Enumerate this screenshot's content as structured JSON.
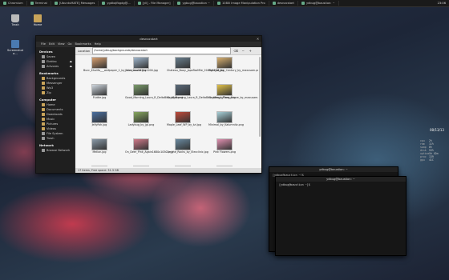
{
  "taskbar": {
    "items": [
      {
        "label": "Chromium"
      },
      {
        "label": "Terminal"
      },
      {
        "label": "[UbuntuMATE] Messages"
      },
      {
        "label": "ygdkajfbgdg@..."
      },
      {
        "label": "[yll] - File Manager]"
      },
      {
        "label": "ygbug@baustion ~"
      },
      {
        "label": "1080i Image Manipulation Pro"
      },
      {
        "label": "desnacstart"
      },
      {
        "label": "ydbug@baustion: ~"
      }
    ],
    "clock": "23:06"
  },
  "desktop": {
    "icons": [
      {
        "label": "Trash"
      },
      {
        "label": "Home"
      },
      {
        "label": "Screenshot a..."
      }
    ]
  },
  "file_manager": {
    "title": "desnacstart",
    "menu": [
      "File",
      "Edit",
      "View",
      "Go",
      "Bookmarks",
      "Help"
    ],
    "sidebar": {
      "devices_heading": "Devices",
      "devices": [
        {
          "label": "Seven"
        },
        {
          "label": "Elektro"
        },
        {
          "label": "Artvores"
        }
      ],
      "bookmarks_heading": "Bookmarks",
      "bookmarks": [
        {
          "label": "Backgrounds"
        },
        {
          "label": "Messenger"
        },
        {
          "label": "Wp3"
        },
        {
          "label": "Zip"
        }
      ],
      "computer_heading": "Computer",
      "computer": [
        {
          "label": "Home"
        },
        {
          "label": "Documents"
        },
        {
          "label": "Downloads"
        },
        {
          "label": "Music"
        },
        {
          "label": "Pictures"
        },
        {
          "label": "Videos"
        },
        {
          "label": "File System"
        },
        {
          "label": "Trash"
        }
      ],
      "network_heading": "Network",
      "network": [
        {
          "label": "Browse Network"
        }
      ]
    },
    "location_label": "Location",
    "location_value": "/home/ydbug/backgrounds/desnacstart",
    "files": [
      {
        "name": "Bucc_Khalifa___wallpaper_1_by_mox_laseke.jpg",
        "color": "#d9a070"
      },
      {
        "name": "Calmness1920x1200.jpg",
        "color": "#9fb6cc"
      },
      {
        "name": "Chateau_Nooy_JapoTaaMile_2048x1000.jpg",
        "color": "#6a7f8e"
      },
      {
        "name": "Fight_of_the_Century_by_maxusam.png",
        "color": "#d8b070"
      },
      {
        "name": "Fluttie.jpg",
        "color": "#cfd7df"
      },
      {
        "name": "Good_Morning_Laura_R_DeltaBink_Aleo.png",
        "color": "#7a9a6a"
      },
      {
        "name": "Good_Morning_Laura_R_DeltaBink_Aleo_byTang.png",
        "color": "#5a6a7a"
      },
      {
        "name": "Greetings_From_Above_by_maxusam.png",
        "color": "#e2c24a"
      },
      {
        "name": "Jellyfish.jpg",
        "color": "#4a6fa0"
      },
      {
        "name": "Ladybug_by_jgi.png",
        "color": "#88a860"
      },
      {
        "name": "Maple_Leaf_WP_by_tzi.jpg",
        "color": "#c04a3a"
      },
      {
        "name": "Minimal_by_Kalumnitz.png",
        "color": "#a8d0d8"
      },
      {
        "name": "Mellon.jpg",
        "color": "#8a9aa8"
      },
      {
        "name": "On_Deer_Pink_Again1680x1050.png",
        "color": "#d07a8a"
      },
      {
        "name": "On_the_Rocks_by_Elecclinic.jpg",
        "color": "#6a8aa0"
      },
      {
        "name": "Pink Flowers.png",
        "color": "#e090b0"
      },
      {
        "name": "",
        "color": "#8ab0d8"
      },
      {
        "name": "",
        "color": "#c07040"
      },
      {
        "name": "",
        "color": "#5070a0"
      },
      {
        "name": "",
        "color": "#708090"
      }
    ],
    "status": "17 items, Free space: 31.3 GB"
  },
  "terminals": [
    {
      "title": "ydbug@baustion: ~",
      "prompt": "[ydbug@baustion ~]$"
    },
    {
      "title": "ydbug@baustion: ~",
      "prompt": "[ydbug@baustion ~]$"
    }
  ],
  "conky": {
    "date": "08/13/13",
    "rows": [
      {
        "k": "cpu",
        "v": "2%"
      },
      {
        "k": "ram",
        "v": "11%"
      },
      {
        "k": "swap",
        "v": "0%"
      },
      {
        "k": "disk",
        "v": "53%"
      },
      {
        "k": "uptime",
        "v": "1h 42m"
      },
      {
        "k": "proc",
        "v": "139"
      },
      {
        "k": "gpu",
        "v": "41C"
      }
    ]
  },
  "colors": {
    "folder": "#c9a45a",
    "panel_bg": "#1f1f1f",
    "content_bg": "#f4f4f4"
  }
}
